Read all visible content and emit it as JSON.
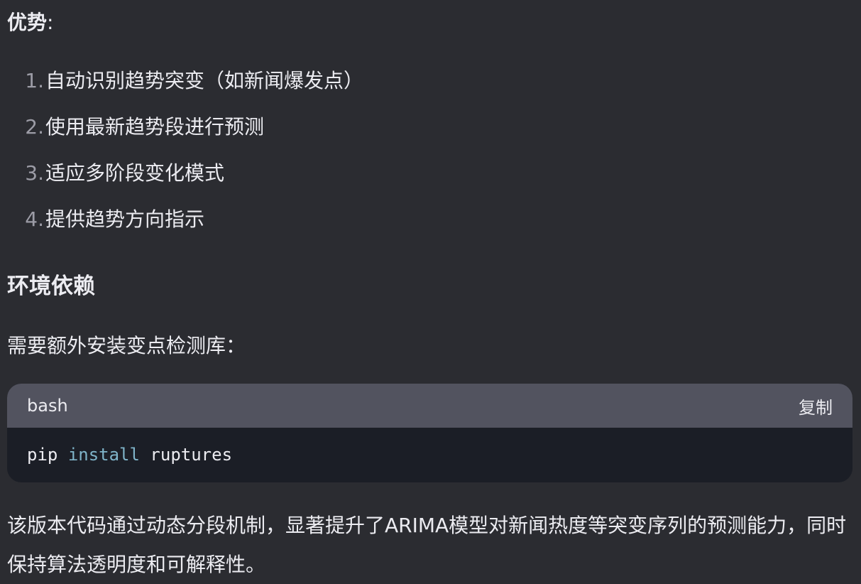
{
  "advantages": {
    "label": "优势",
    "colon": ":",
    "items": [
      {
        "num": "1.",
        "text": "自动识别趋势突变（如新闻爆发点）"
      },
      {
        "num": "2.",
        "text": "使用最新趋势段进行预测"
      },
      {
        "num": "3.",
        "text": "适应多阶段变化模式"
      },
      {
        "num": "4.",
        "text": "提供趋势方向指示"
      }
    ]
  },
  "environment": {
    "heading": "环境依赖",
    "description": "需要额外安装变点检测库："
  },
  "code_block": {
    "language": "bash",
    "copy_label": "复制",
    "tokens": {
      "cmd": "pip",
      "keyword": "install",
      "arg": "ruptures"
    }
  },
  "summary": "该版本代码通过动态分段机制，显著提升了ARIMA模型对新闻热度等突变序列的预测能力，同时保持算法透明度和可解释性。",
  "colors": {
    "background": "#2b2c31",
    "code_header": "#52535f",
    "code_body": "#1b1e26",
    "keyword": "#7fb4c9"
  }
}
